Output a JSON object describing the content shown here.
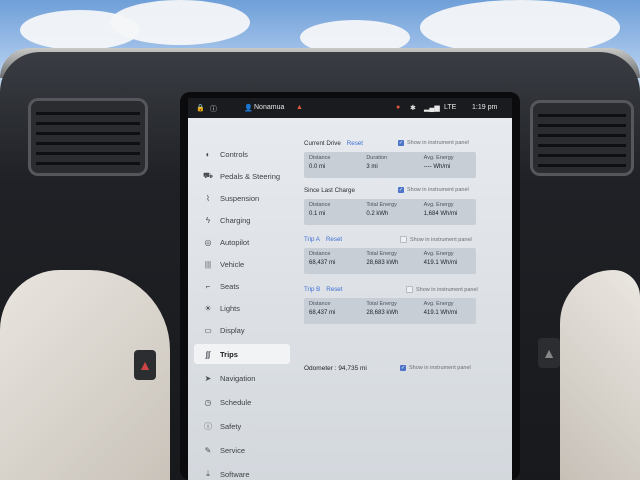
{
  "status_bar": {
    "profile_name": "Nonamua",
    "time": "1:19 pm"
  },
  "sidebar": {
    "items": [
      {
        "label": "Controls",
        "icon": "toggle-icon"
      },
      {
        "label": "Pedals & Steering",
        "icon": "car-icon"
      },
      {
        "label": "Suspension",
        "icon": "suspension-icon"
      },
      {
        "label": "Charging",
        "icon": "bolt-icon"
      },
      {
        "label": "Autopilot",
        "icon": "steering-wheel-icon"
      },
      {
        "label": "Vehicle",
        "icon": "vehicle-icon"
      },
      {
        "label": "Seats",
        "icon": "seat-icon"
      },
      {
        "label": "Lights",
        "icon": "bulb-icon"
      },
      {
        "label": "Display",
        "icon": "display-icon"
      },
      {
        "label": "Trips",
        "icon": "trips-icon",
        "active": true
      },
      {
        "label": "Navigation",
        "icon": "navigation-icon"
      },
      {
        "label": "Schedule",
        "icon": "clock-icon"
      },
      {
        "label": "Safety",
        "icon": "safety-icon"
      },
      {
        "label": "Service",
        "icon": "wrench-icon"
      },
      {
        "label": "Software",
        "icon": "download-icon"
      }
    ]
  },
  "current_drive": {
    "title": "Current Drive",
    "reset": "Reset",
    "checkbox_label": "Show in instrument panel",
    "checked": true,
    "stats": [
      {
        "label": "Distance",
        "value": "0.0 mi"
      },
      {
        "label": "Duration",
        "value": "3 mi"
      },
      {
        "label": "Avg. Energy",
        "value": "---- Wh/mi"
      }
    ]
  },
  "since_last_charge": {
    "title": "Since Last Charge",
    "checkbox_label": "Show in instrument panel",
    "checked": true,
    "stats": [
      {
        "label": "Distance",
        "value": "0.1 mi"
      },
      {
        "label": "Total Energy",
        "value": "0.2 kWh"
      },
      {
        "label": "Avg. Energy",
        "value": "1,684 Wh/mi"
      }
    ]
  },
  "trip_a": {
    "title": "Trip A",
    "reset": "Reset",
    "checkbox_label": "Show in instrument panel",
    "checked": false,
    "stats": [
      {
        "label": "Distance",
        "value": "68,437 mi"
      },
      {
        "label": "Total Energy",
        "value": "28,683 kWh"
      },
      {
        "label": "Avg. Energy",
        "value": "419.1 Wh/mi"
      }
    ]
  },
  "trip_b": {
    "title": "Trip B",
    "reset": "Reset",
    "checkbox_label": "Show in instrument panel",
    "checked": false,
    "stats": [
      {
        "label": "Distance",
        "value": "68,437 mi"
      },
      {
        "label": "Total Energy",
        "value": "28,683 kWh"
      },
      {
        "label": "Avg. Energy",
        "value": "419.1 Wh/mi"
      }
    ]
  },
  "odometer": {
    "text": "Odometer : 94,735 mi",
    "checkbox_label": "Show in instrument panel",
    "checked": true
  }
}
